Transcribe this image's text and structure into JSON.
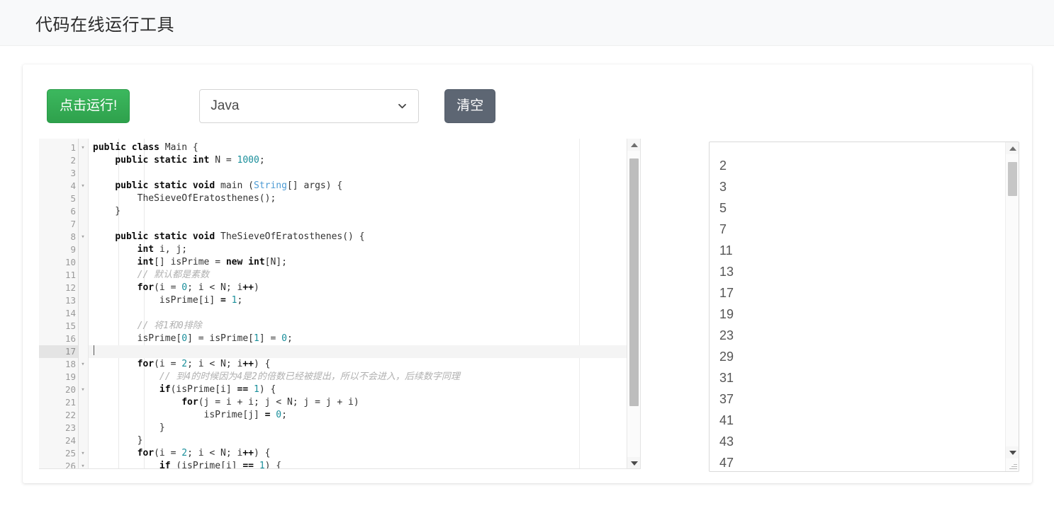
{
  "header": {
    "title": "代码在线运行工具"
  },
  "toolbar": {
    "run_label": "点击运行!",
    "language_value": "Java",
    "language_options": [
      "Java"
    ],
    "clear_label": "清空",
    "chevron_icon": "chevron-down-icon"
  },
  "editor": {
    "active_line": 17,
    "fold_lines": [
      1,
      4,
      8,
      18,
      20,
      25,
      26
    ],
    "lines": [
      {
        "n": 1,
        "tokens": [
          {
            "t": "kw",
            "v": "public class "
          },
          {
            "t": "pl",
            "v": "Main {"
          }
        ]
      },
      {
        "n": 2,
        "tokens": [
          {
            "t": "pl",
            "v": "    "
          },
          {
            "t": "kw",
            "v": "public static int "
          },
          {
            "t": "pl",
            "v": "N = "
          },
          {
            "t": "num",
            "v": "1000"
          },
          {
            "t": "pl",
            "v": ";"
          }
        ]
      },
      {
        "n": 3,
        "tokens": []
      },
      {
        "n": 4,
        "tokens": [
          {
            "t": "pl",
            "v": "    "
          },
          {
            "t": "kw",
            "v": "public static void "
          },
          {
            "t": "pl",
            "v": "main ("
          },
          {
            "t": "typ",
            "v": "String"
          },
          {
            "t": "pl",
            "v": "[] args) {"
          }
        ]
      },
      {
        "n": 5,
        "tokens": [
          {
            "t": "pl",
            "v": "        TheSieveOfEratosthenes();"
          }
        ]
      },
      {
        "n": 6,
        "tokens": [
          {
            "t": "pl",
            "v": "    }"
          }
        ]
      },
      {
        "n": 7,
        "tokens": []
      },
      {
        "n": 8,
        "tokens": [
          {
            "t": "pl",
            "v": "    "
          },
          {
            "t": "kw",
            "v": "public static void "
          },
          {
            "t": "pl",
            "v": "TheSieveOfEratosthenes() {"
          }
        ]
      },
      {
        "n": 9,
        "tokens": [
          {
            "t": "pl",
            "v": "        "
          },
          {
            "t": "kw",
            "v": "int "
          },
          {
            "t": "pl",
            "v": "i, j;"
          }
        ]
      },
      {
        "n": 10,
        "tokens": [
          {
            "t": "pl",
            "v": "        "
          },
          {
            "t": "kw",
            "v": "int"
          },
          {
            "t": "pl",
            "v": "[] isPrime = "
          },
          {
            "t": "kw",
            "v": "new int"
          },
          {
            "t": "pl",
            "v": "[N];"
          }
        ]
      },
      {
        "n": 11,
        "tokens": [
          {
            "t": "pl",
            "v": "        "
          },
          {
            "t": "cmt",
            "v": "// 默认都是素数"
          }
        ]
      },
      {
        "n": 12,
        "tokens": [
          {
            "t": "pl",
            "v": "        "
          },
          {
            "t": "kw",
            "v": "for"
          },
          {
            "t": "pl",
            "v": "(i = "
          },
          {
            "t": "num",
            "v": "0"
          },
          {
            "t": "pl",
            "v": "; i < N; i"
          },
          {
            "t": "kw",
            "v": "++"
          },
          {
            "t": "pl",
            "v": ")"
          }
        ]
      },
      {
        "n": 13,
        "tokens": [
          {
            "t": "pl",
            "v": "            isPrime[i] "
          },
          {
            "t": "kw",
            "v": "= "
          },
          {
            "t": "num",
            "v": "1"
          },
          {
            "t": "pl",
            "v": ";"
          }
        ]
      },
      {
        "n": 14,
        "tokens": []
      },
      {
        "n": 15,
        "tokens": [
          {
            "t": "pl",
            "v": "        "
          },
          {
            "t": "cmt",
            "v": "// 将1和0排除"
          }
        ]
      },
      {
        "n": 16,
        "tokens": [
          {
            "t": "pl",
            "v": "        isPrime["
          },
          {
            "t": "num",
            "v": "0"
          },
          {
            "t": "pl",
            "v": "] = isPrime["
          },
          {
            "t": "num",
            "v": "1"
          },
          {
            "t": "pl",
            "v": "] = "
          },
          {
            "t": "num",
            "v": "0"
          },
          {
            "t": "pl",
            "v": ";"
          }
        ]
      },
      {
        "n": 17,
        "tokens": []
      },
      {
        "n": 18,
        "tokens": [
          {
            "t": "pl",
            "v": "        "
          },
          {
            "t": "kw",
            "v": "for"
          },
          {
            "t": "pl",
            "v": "(i = "
          },
          {
            "t": "num",
            "v": "2"
          },
          {
            "t": "pl",
            "v": "; i < N; i"
          },
          {
            "t": "kw",
            "v": "++"
          },
          {
            "t": "pl",
            "v": ") {"
          }
        ]
      },
      {
        "n": 19,
        "tokens": [
          {
            "t": "pl",
            "v": "            "
          },
          {
            "t": "cmt",
            "v": "// 到4的时候因为4是2的倍数已经被提出，所以不会进入，后续数字同理"
          }
        ]
      },
      {
        "n": 20,
        "tokens": [
          {
            "t": "pl",
            "v": "            "
          },
          {
            "t": "kw",
            "v": "if"
          },
          {
            "t": "pl",
            "v": "(isPrime[i] "
          },
          {
            "t": "kw",
            "v": "== "
          },
          {
            "t": "num",
            "v": "1"
          },
          {
            "t": "pl",
            "v": ") {"
          }
        ]
      },
      {
        "n": 21,
        "tokens": [
          {
            "t": "pl",
            "v": "                "
          },
          {
            "t": "kw",
            "v": "for"
          },
          {
            "t": "pl",
            "v": "(j = i + i; j < N; j = j + i)"
          }
        ]
      },
      {
        "n": 22,
        "tokens": [
          {
            "t": "pl",
            "v": "                    isPrime[j] "
          },
          {
            "t": "kw",
            "v": "= "
          },
          {
            "t": "num",
            "v": "0"
          },
          {
            "t": "pl",
            "v": ";"
          }
        ]
      },
      {
        "n": 23,
        "tokens": [
          {
            "t": "pl",
            "v": "            }"
          }
        ]
      },
      {
        "n": 24,
        "tokens": [
          {
            "t": "pl",
            "v": "        }"
          }
        ]
      },
      {
        "n": 25,
        "tokens": [
          {
            "t": "pl",
            "v": "        "
          },
          {
            "t": "kw",
            "v": "for"
          },
          {
            "t": "pl",
            "v": "(i = "
          },
          {
            "t": "num",
            "v": "2"
          },
          {
            "t": "pl",
            "v": "; i < N; i"
          },
          {
            "t": "kw",
            "v": "++"
          },
          {
            "t": "pl",
            "v": ") {"
          }
        ]
      },
      {
        "n": 26,
        "tokens": [
          {
            "t": "pl",
            "v": "            "
          },
          {
            "t": "kw",
            "v": "if "
          },
          {
            "t": "pl",
            "v": "(isPrime[i] "
          },
          {
            "t": "kw",
            "v": "== "
          },
          {
            "t": "num",
            "v": "1"
          },
          {
            "t": "pl",
            "v": ") {"
          }
        ]
      }
    ]
  },
  "output": {
    "lines": [
      "2",
      "3",
      "5",
      "7",
      "11",
      "13",
      "17",
      "19",
      "23",
      "29",
      "31",
      "37",
      "41",
      "43",
      "47"
    ]
  },
  "colors": {
    "run_green": "#34a853",
    "clear_gray": "#5d6673",
    "keyword": "#0b0b0b",
    "number": "#1a8f9b",
    "type": "#4d9bd4",
    "comment": "#b0b0b0",
    "header_bg": "#f8f9fa"
  }
}
